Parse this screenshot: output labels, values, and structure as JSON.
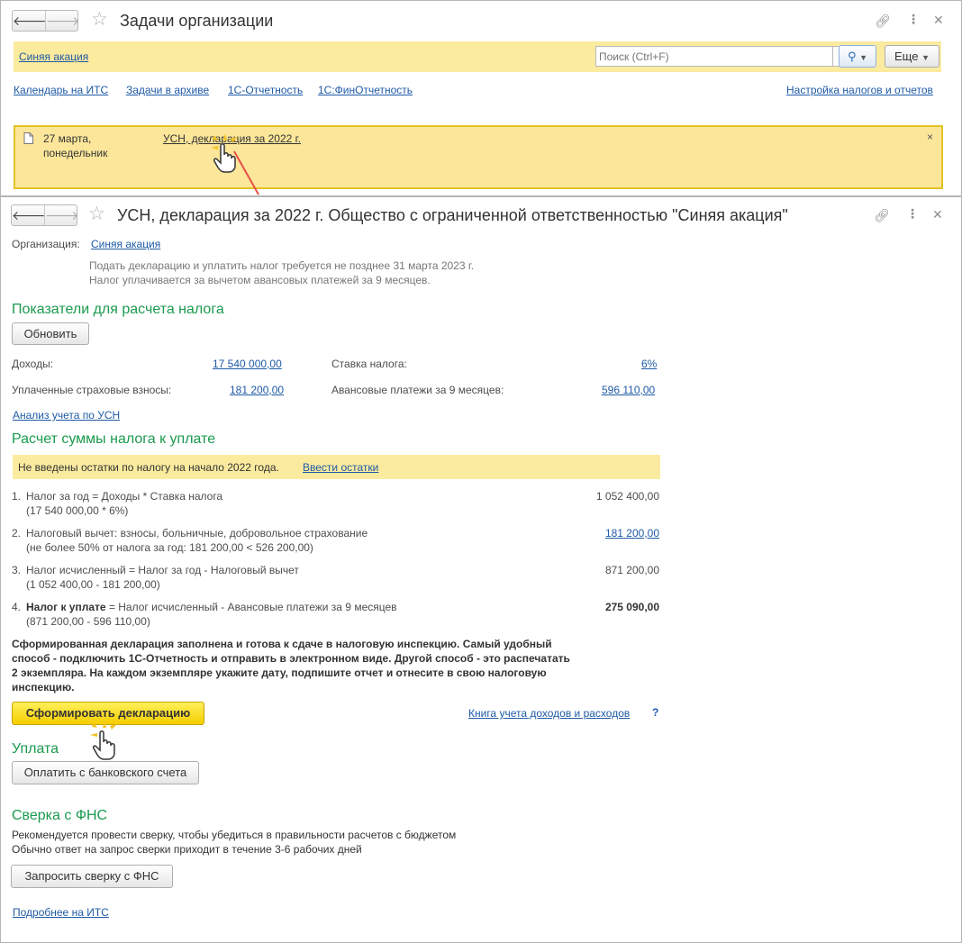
{
  "window1": {
    "title": "Задачи организации",
    "search_filter_link": "Синяя акация",
    "search_placeholder": "Поиск (Ctrl+F)",
    "search_clear": "×",
    "more_button": "Еще",
    "links": [
      "Календарь на ИТС",
      "Задачи в архиве",
      "1С-Отчетность",
      "1С:ФинОтчетность"
    ],
    "settings_link": "Настройка налогов и отчетов",
    "task": {
      "date_line1": "27 марта,",
      "date_line2": "понедельник",
      "title": "УСН, декларация за 2022 г.",
      "close": "×"
    }
  },
  "window2": {
    "title": "УСН, декларация за 2022 г. Общество с ограниченной ответственностью \"Синяя акация\"",
    "org_label": "Организация:",
    "org_value": "Синяя акация",
    "note1": "Подать декларацию и уплатить налог требуется не позднее 31 марта 2023 г.",
    "note2": "Налог уплачивается за вычетом авансовых платежей за 9 месяцев.",
    "indicators": {
      "title": "Показатели для расчета налога",
      "refresh_button": "Обновить",
      "income_label": "Доходы:",
      "income_value": "17 540 000,00",
      "rate_label": "Ставка налога:",
      "rate_value": "6%",
      "insurance_label": "Уплаченные страховые взносы:",
      "insurance_value": "181 200,00",
      "advance_label": "Авансовые платежи за 9 месяцев:",
      "advance_value": "596 110,00",
      "analysis_link": "Анализ учета по УСН"
    },
    "calc": {
      "title": "Расчет суммы налога к уплате",
      "warning_text": "Не введены остатки по налогу на начало 2022 года.",
      "warning_link": "Ввести остатки",
      "items": [
        {
          "num": "1.",
          "bold": "",
          "text": "Налог за год = Доходы * Ставка налога",
          "sub": "(17 540 000,00 * 6%)",
          "value": "1 052 400,00"
        },
        {
          "num": "2.",
          "bold": "",
          "text": "Налоговый вычет: взносы, больничные, добровольное страхование",
          "sub": "(не более 50% от налога за год: 181 200,00 < 526 200,00)",
          "value": "181 200,00"
        },
        {
          "num": "3.",
          "bold": "",
          "text": "Налог исчисленный = Налог за год - Налоговый вычет",
          "sub": "(1 052 400,00 - 181 200,00)",
          "value": "871 200,00"
        },
        {
          "num": "4.",
          "bold": "Налог к уплате",
          "text": " = Налог исчисленный - Авансовые платежи за 9 месяцев",
          "sub": "(871 200,00 - 596 110,00)",
          "value": "275 090,00"
        }
      ],
      "summary_lines": [
        "Сформированная декларация заполнена и готова к сдаче в налоговую инспекцию. Самый удобный",
        "способ - подключить 1С-Отчетность и отправить в электронном виде. Другой способ - это распечатать",
        "2 экземпляра. На каждом экземпляре укажите дату, подпишите отчет и отнесите в свою налоговую",
        "инспекцию."
      ],
      "form_button": "Сформировать декларацию",
      "book_link": "Книга учета доходов и расходов",
      "help": "?"
    },
    "payment": {
      "title": "Уплата",
      "pay_button": "Оплатить с банковского счета"
    },
    "reconcile": {
      "title": "Сверка с ФНС",
      "line1": "Рекомендуется провести сверку, чтобы убедиться в правильности расчетов с бюджетом",
      "line2": "Обычно ответ на запрос сверки приходит в течение 3-6 рабочих дней",
      "button": "Запросить сверку с ФНС"
    },
    "more_link": "Подробнее на ИТС"
  },
  "colors": {
    "accent_green": "#1a9a4e",
    "link_blue": "#1f5aa6",
    "banner_yellow": "#fbe69a",
    "primary_yellow": "#f5cd00",
    "pointer_red": "#e8504a"
  }
}
